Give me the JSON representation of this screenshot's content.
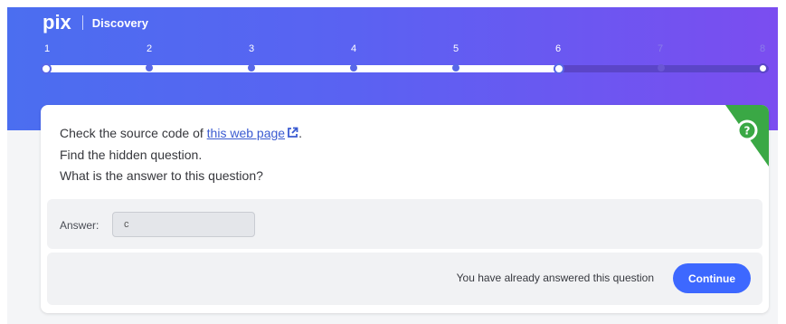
{
  "header": {
    "logo": "pix",
    "section": "Discovery"
  },
  "progress": {
    "steps": [
      "1",
      "2",
      "3",
      "4",
      "5",
      "6",
      "7",
      "8"
    ],
    "current": 6,
    "total": 8
  },
  "challenge": {
    "line1_prefix": "Check the source code of ",
    "link_text": "this web page",
    "line1_suffix": ".",
    "line2": "Find the hidden question.",
    "line3": "What is the answer to this question?",
    "badge_icon": "question-magnifier-icon"
  },
  "answer": {
    "label": "Answer:",
    "value": "c"
  },
  "footer": {
    "status": "You have already answered this question",
    "continue_label": "Continue"
  },
  "colors": {
    "banner_start": "#4b6ef0",
    "banner_end": "#7b4df0",
    "badge": "#3aa845",
    "button": "#3d68ff",
    "link": "#3b5bd1"
  }
}
